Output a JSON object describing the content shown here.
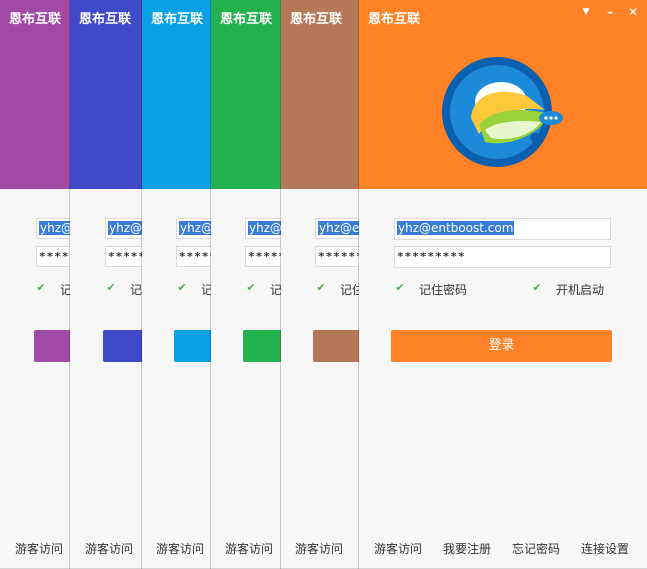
{
  "app_title": "恩布互联",
  "username": "yhz@entboost.com",
  "username_partial": "yhz@en",
  "password_mask": "*********",
  "remember_label": "记住密码",
  "auto_start_label": "开机启动",
  "login_label": "登录",
  "links": {
    "guest": "游客访问",
    "register": "我要注册",
    "forgot": "忘记密码",
    "settings": "连接设置"
  },
  "window_controls": {
    "dropdown": "▼",
    "minimize": "–",
    "close": "✕"
  },
  "theme_colors": {
    "purple": "#a04aa6",
    "indigo": "#4049c8",
    "blue": "#09a0e6",
    "green": "#23b14d",
    "brown": "#b5795a",
    "orange": "#ff8226"
  }
}
